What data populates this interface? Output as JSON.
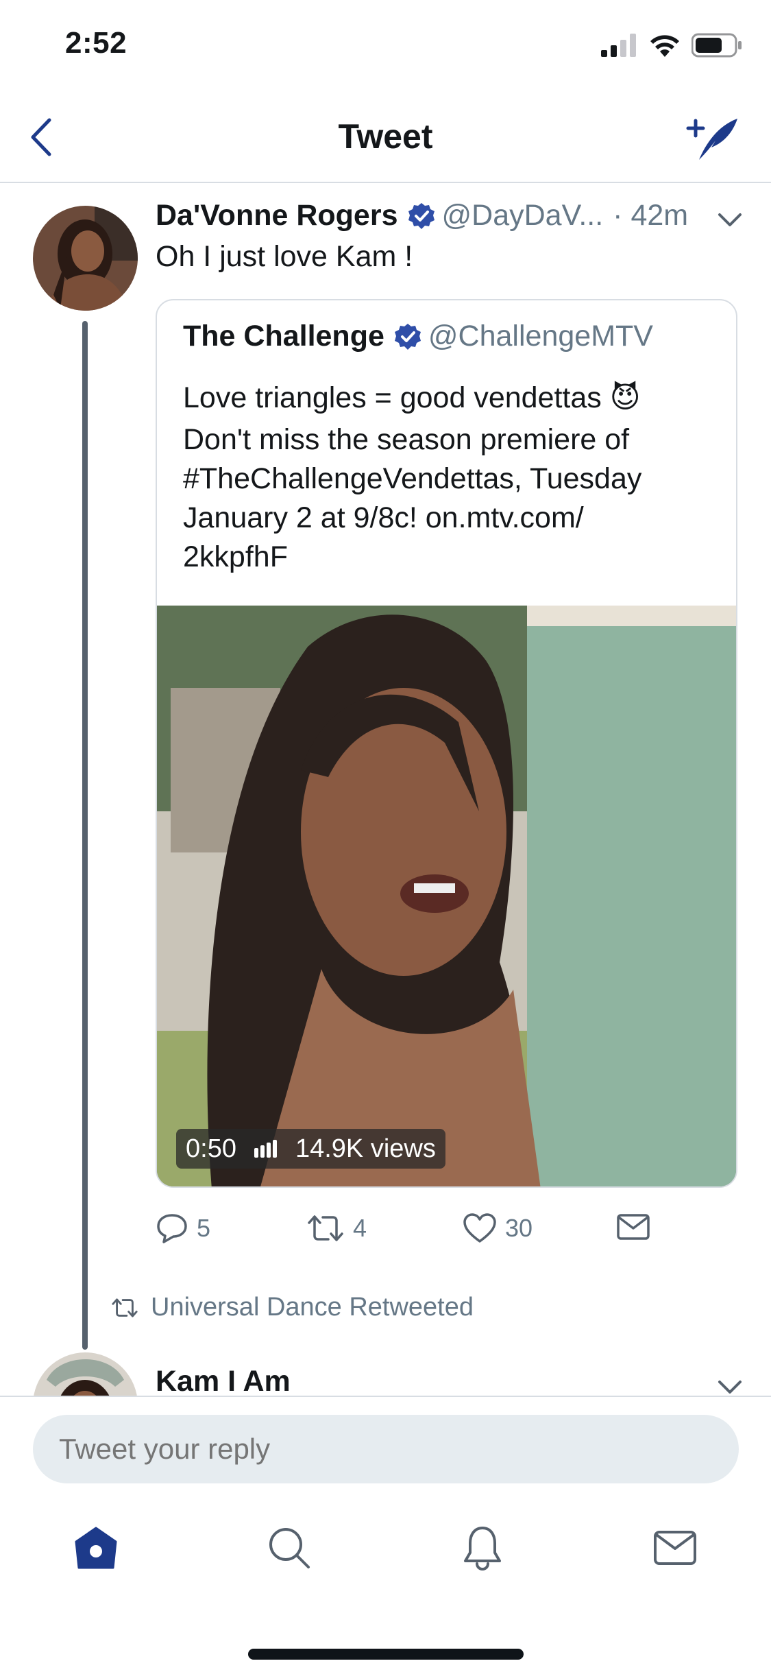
{
  "status_bar": {
    "time": "2:52"
  },
  "header": {
    "title": "Tweet"
  },
  "tweet": {
    "author_name": "Da'Vonne Rogers",
    "handle": "@DayDaV...",
    "time": "· 42m",
    "text": "Oh I just love Kam !",
    "quoted": {
      "author_name": "The Challenge",
      "handle": "@ChallengeMTV",
      "text_line1": "Love triangles = good vendettas 😈",
      "text_line2": "Don't miss the season premiere of",
      "text_line3": "#TheChallengeVendettas, Tuesday",
      "text_line4": "January 2 at 9/8c! on.mtv.com/",
      "text_line5": "2kkpfhF",
      "video_duration": "0:50",
      "video_views": "14.9K views"
    },
    "actions": {
      "replies": "5",
      "retweets": "4",
      "likes": "30"
    }
  },
  "retweet_banner": {
    "text": "Universal Dance Retweeted"
  },
  "next_tweet": {
    "author_name": "Kam I Am"
  },
  "reply": {
    "placeholder": "Tweet your reply"
  },
  "colors": {
    "accent": "#1d3a8a",
    "verified": "#2f4ea8",
    "muted": "#657786"
  },
  "icons": [
    "back-chevron-icon",
    "compose-tweet-icon",
    "verified-badge-icon",
    "chevron-down-icon",
    "reply-icon",
    "retweet-icon",
    "like-icon",
    "share-dm-icon",
    "home-icon",
    "search-icon",
    "notifications-icon",
    "messages-icon"
  ]
}
